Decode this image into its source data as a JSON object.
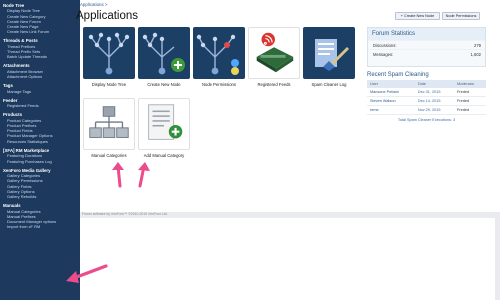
{
  "sidebar": {
    "groups": [
      {
        "title": "Node Tree",
        "items": [
          "Display Node Tree",
          "Create New Category",
          "Create New Forum",
          "Create New Page",
          "Create New Link Forum"
        ]
      },
      {
        "title": "Threads & Posts",
        "items": [
          "Thread Prefixes",
          "Thread Prefix Sets",
          "Batch Update Threads"
        ]
      },
      {
        "title": "Attachments",
        "items": [
          "Attachment Browser",
          "Attachment Options"
        ]
      },
      {
        "title": "Tags",
        "items": [
          "Manage Tags"
        ]
      },
      {
        "title": "Feeder",
        "items": [
          "Registered Feeds"
        ]
      },
      {
        "title": "Products",
        "items": [
          "Product Categories",
          "Product Prefixes",
          "Product Fields",
          "Product Manager Options",
          "Resources Statistiques"
        ]
      },
      {
        "title": "[XFA] RM Marketplace",
        "items": [
          "Featuring Durations",
          "Featuring Purchases Log"
        ]
      },
      {
        "title": "XenForo Media Gallery",
        "items": [
          "Gallery Categories",
          "Gallery Permissions",
          "Gallery Fields",
          "Gallery Options",
          "Gallery Rebuilds"
        ]
      },
      {
        "title": "Manuals",
        "items": [
          "Manual Categories",
          "Manual Prefixes",
          "Document Manager options",
          "Import from xF RM"
        ]
      }
    ]
  },
  "breadcrumb": "Applications >",
  "page_title": "Applications",
  "buttons": {
    "create_node": "+ Create New Node",
    "node_permissions": "Node Permissions"
  },
  "tiles": [
    {
      "label": "Display Node Tree",
      "icon": "node-tree-icon"
    },
    {
      "label": "Create New Node",
      "icon": "create-node-icon"
    },
    {
      "label": "Node Permissions",
      "icon": "node-permissions-icon"
    },
    {
      "label": "Registered Feeds",
      "icon": "rss-feed-icon"
    },
    {
      "label": "Spam Cleaner Log",
      "icon": "spam-cleaner-icon"
    },
    {
      "label": "Manual Categories",
      "icon": "sitemap-icon"
    },
    {
      "label": "Add Manual Category",
      "icon": "add-document-icon"
    }
  ],
  "forum_statistics": {
    "title": "Forum Statistics",
    "rows": [
      {
        "label": "Discussions:",
        "value": "279"
      },
      {
        "label": "Messages:",
        "value": "1,602"
      }
    ]
  },
  "spam_cleaning": {
    "title": "Recent Spam Cleaning",
    "columns": [
      "User",
      "Date",
      "Moderator"
    ],
    "rows": [
      {
        "user": "Mansone Pellaini",
        "date": "Dec 31, 2015",
        "moderator": "Freded"
      },
      {
        "user": "Steven Watson",
        "date": "Dec 14, 2015",
        "moderator": "Freded"
      },
      {
        "user": "reme",
        "date": "Nov 29, 2015",
        "moderator": "Freded"
      }
    ],
    "footer": "Total Spam Cleaner Executions: 3"
  },
  "footer": "Forum software by XenForo™ ©2010-2015 XenForo Ltd.",
  "colors": {
    "sidebar_bg": "#1d3a5e",
    "accent": "#2b5a8c",
    "annotation_arrow": "#ea4c8c"
  }
}
